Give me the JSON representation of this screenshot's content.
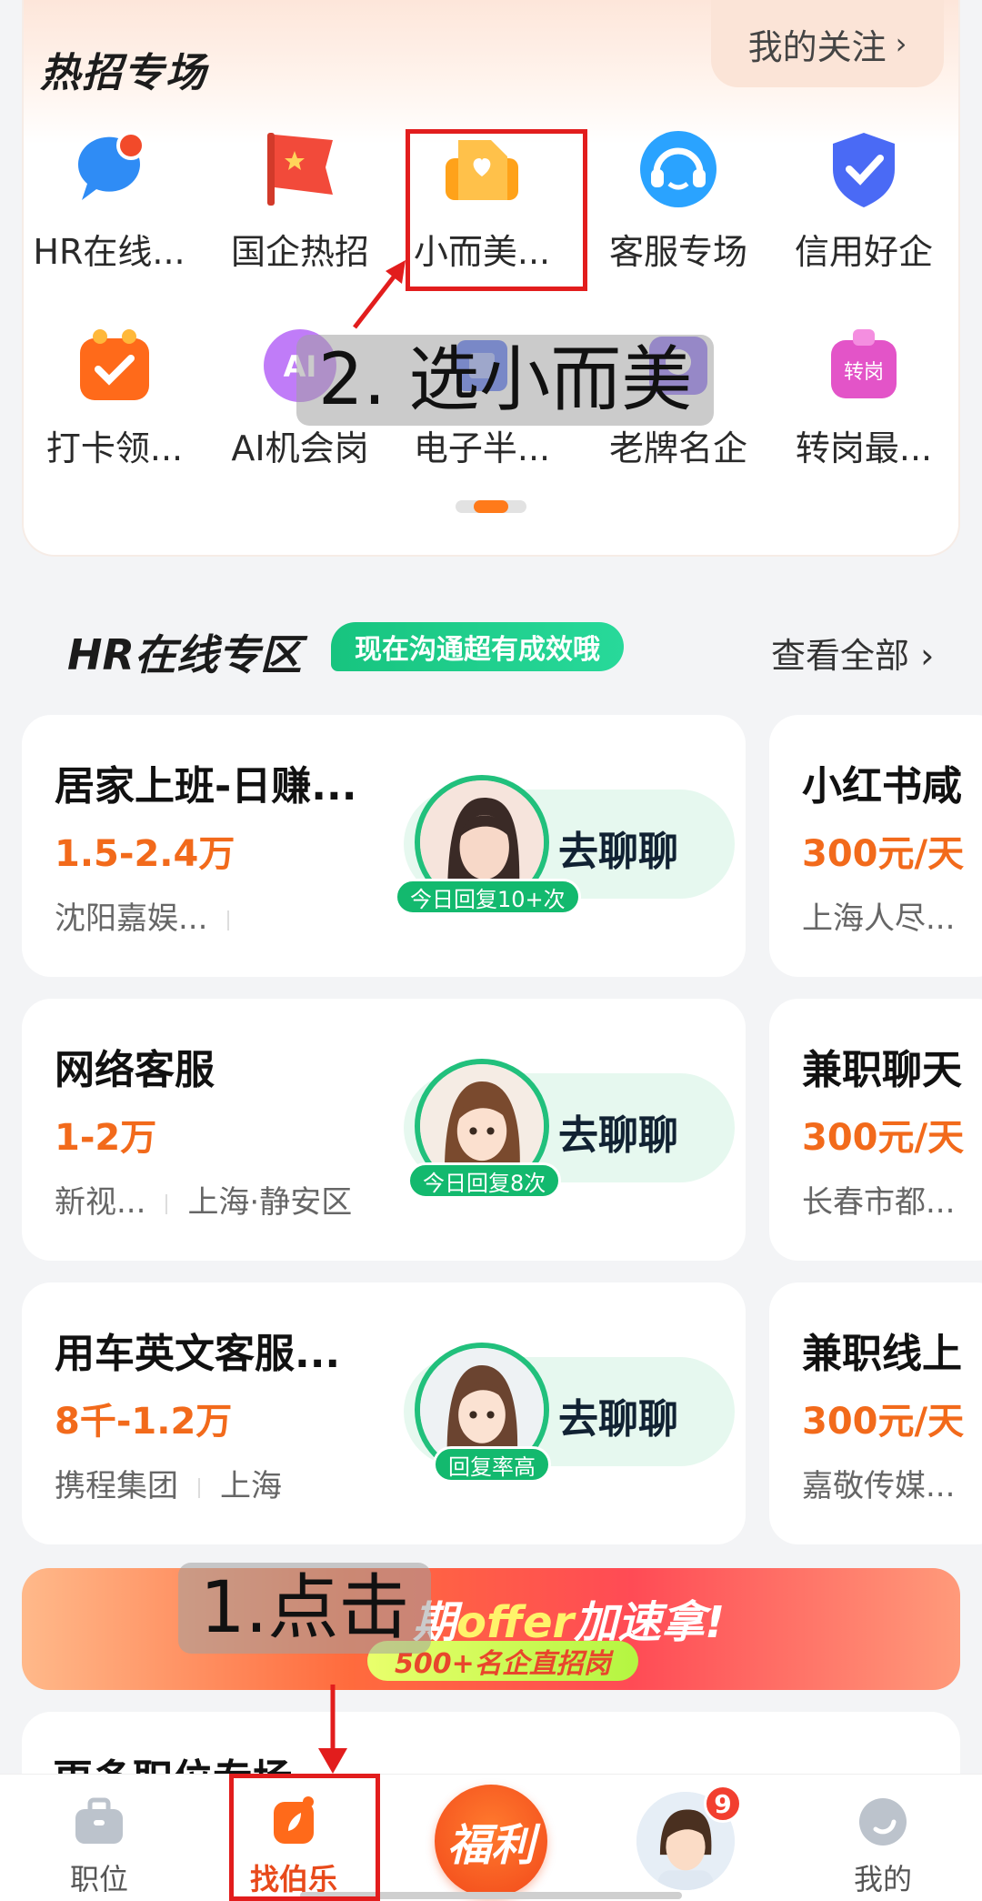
{
  "hot_section": {
    "title": "热招专场",
    "follow_label": "我的关注",
    "categories_row1": [
      {
        "label": "HR在线...",
        "icon": "chat-bubble-icon",
        "color": "#2f8cf5"
      },
      {
        "label": "国企热招",
        "icon": "flag-icon",
        "color": "#f24a3a"
      },
      {
        "label": "小而美...",
        "icon": "heart-folder-icon",
        "color": "#ffa21a"
      },
      {
        "label": "客服专场",
        "icon": "headset-icon",
        "color": "#2aa3ff"
      },
      {
        "label": "信用好企",
        "icon": "shield-check-icon",
        "color": "#4a6af5"
      }
    ],
    "categories_row2": [
      {
        "label": "打卡领...",
        "icon": "checkin-box-icon",
        "color": "#ff6a1a"
      },
      {
        "label": "AI机会岗",
        "icon": "ai-icon",
        "color": "#b56cf5"
      },
      {
        "label": "电子半...",
        "icon": "chip-icon",
        "color": "#4a6af5"
      },
      {
        "label": "老牌名企",
        "icon": "badge-icon",
        "color": "#8a6cf5"
      },
      {
        "label": "转岗最...",
        "icon": "transfer-box-icon",
        "color": "#e354c8"
      }
    ]
  },
  "hr_section": {
    "title": "HR在线专区",
    "badge": "现在沟通超有成效哦",
    "see_all": "查看全部"
  },
  "jobs": [
    {
      "title": "居家上班-日赚...",
      "salary": "1.5-2.4万",
      "company": "沈阳嘉娱...",
      "location": "",
      "chat": "去聊聊",
      "reply": "今日回复10+次"
    },
    {
      "title": "网络客服",
      "salary": "1-2万",
      "company": "新视...",
      "location": "上海·静安区",
      "chat": "去聊聊",
      "reply": "今日回复8次"
    },
    {
      "title": "用车英文客服...",
      "salary": "8千-1.2万",
      "company": "携程集团",
      "location": "上海",
      "chat": "去聊聊",
      "reply": "回复率高"
    }
  ],
  "jobs_right": [
    {
      "title": "小红书咸",
      "salary": "300元/天",
      "company": "上海人尽..."
    },
    {
      "title": "兼职聊天",
      "salary": "300元/天",
      "company": "长春市都..."
    },
    {
      "title": "兼职线上",
      "salary": "300元/天",
      "company": "嘉敬传媒..."
    }
  ],
  "banner": {
    "title_pre": "期",
    "title_offer": "offer",
    "title_post": "加速拿!",
    "subtitle": "500+名企直招岗"
  },
  "more_section": {
    "title": "更多职位专场"
  },
  "tabbar": {
    "tabs": [
      {
        "label": "职位",
        "icon": "briefcase-icon"
      },
      {
        "label": "找伯乐",
        "icon": "leaf-card-icon"
      },
      {
        "label": "福利",
        "icon": "gift-icon"
      },
      {
        "label": "",
        "icon": "avatar-icon"
      },
      {
        "label": "我的",
        "icon": "profile-icon"
      }
    ],
    "notif_count": "9"
  },
  "annotations": {
    "step1": "1.点击",
    "step2": "2. 选小而美"
  },
  "colors": {
    "accent": "#f26a1b",
    "green": "#17c47f",
    "annotation_red": "#e21d1d"
  }
}
